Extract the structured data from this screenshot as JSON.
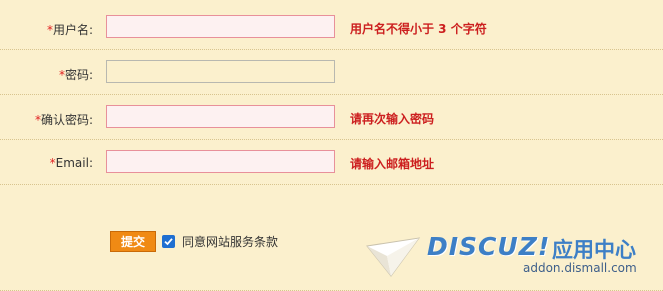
{
  "form": {
    "username": {
      "label": "用户名:",
      "value": "",
      "error": "用户名不得小于 3 个字符"
    },
    "password": {
      "label": "密码:",
      "value": ""
    },
    "confirm": {
      "label": "确认密码:",
      "value": "",
      "error": "请再次输入密码"
    },
    "email": {
      "label": "Email:",
      "value": "",
      "error": "请输入邮箱地址"
    },
    "required_mark": "*",
    "submit_label": "提交",
    "agree_label": "同意网站服务条款",
    "agree_checked": true
  },
  "watermark": {
    "brand": "DISCUZ!",
    "brand_cn": "应用中心",
    "url": "addon.dismall.com"
  },
  "colors": {
    "background": "#fbf0cd",
    "error_text": "#cc1f1f",
    "required_star": "#e02020",
    "submit_bg": "#f08a14",
    "checkbox": "#1f6fd1",
    "brand": "#3d7fc6"
  }
}
